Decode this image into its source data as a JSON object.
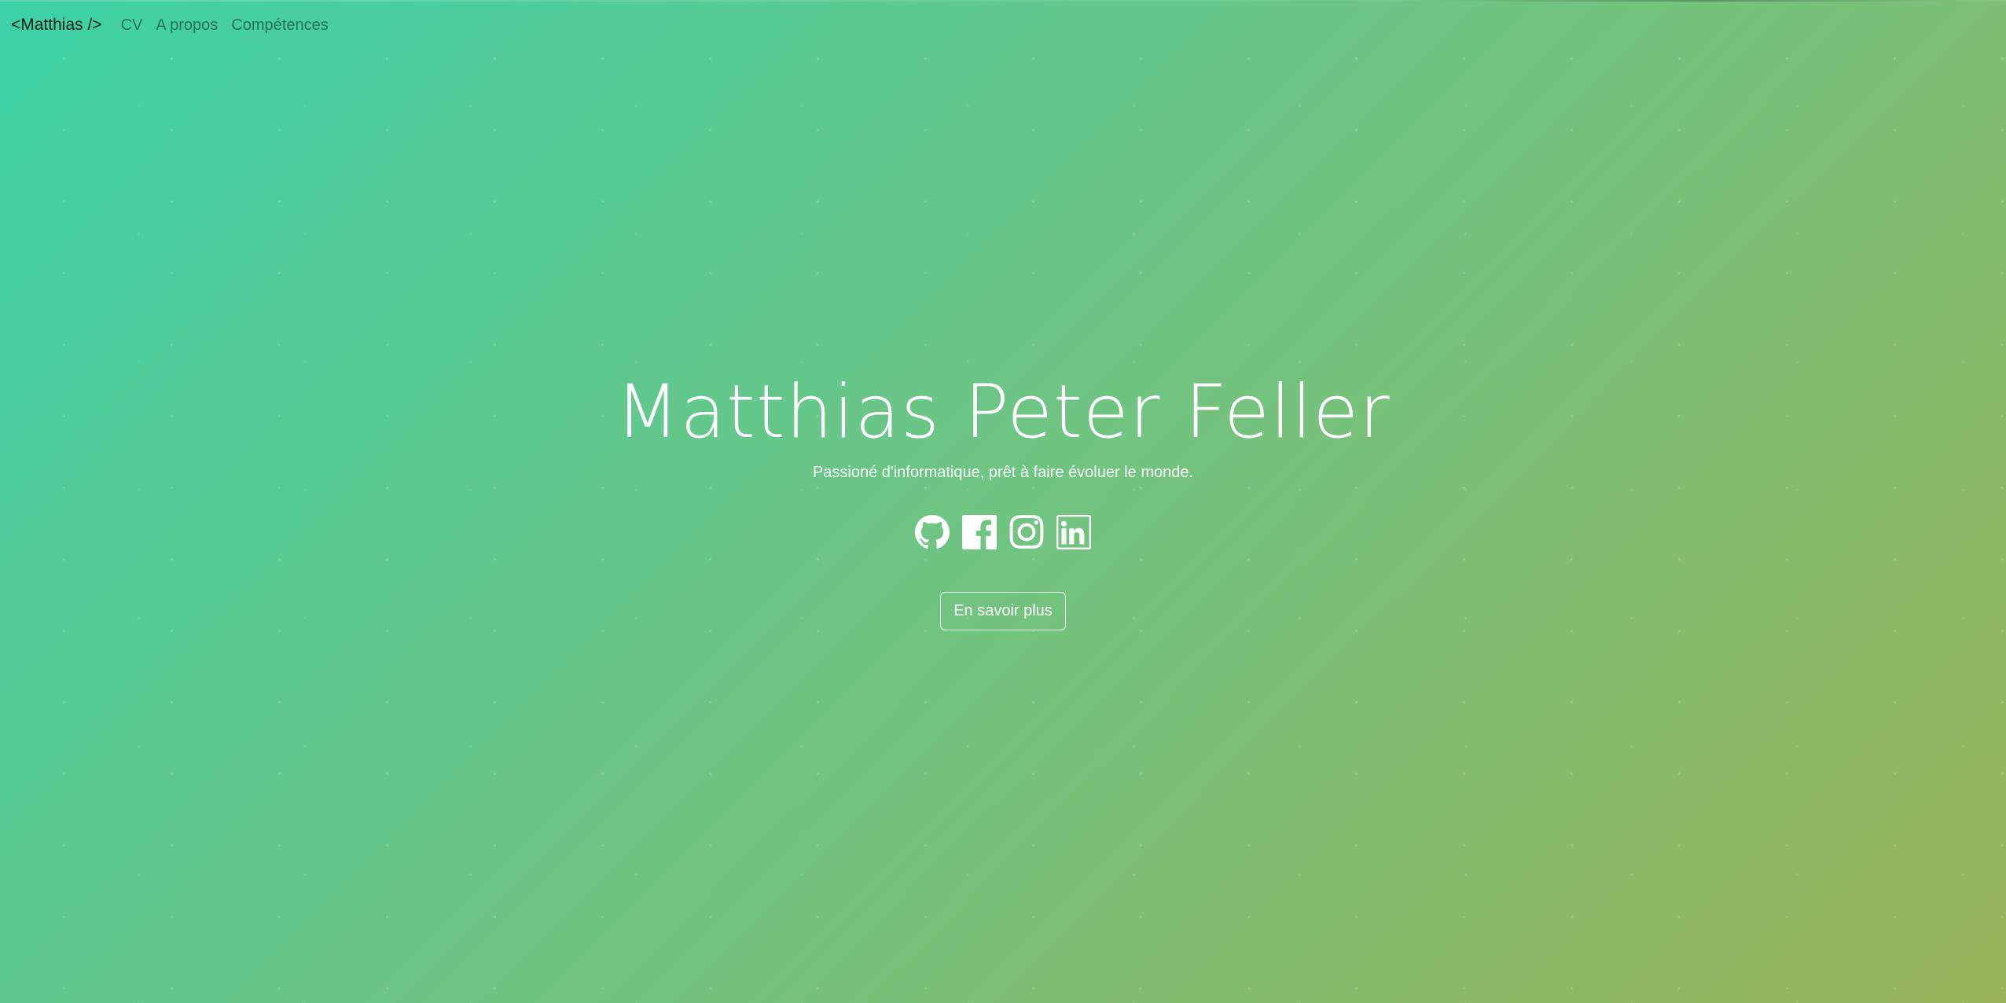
{
  "nav": {
    "brand": "<Matthias />",
    "links": [
      "CV",
      "A propos",
      "Compétences"
    ]
  },
  "hero": {
    "name": "Matthias Peter Feller",
    "tagline": "Passioné d'informatique, prêt à faire évoluer le monde.",
    "cta_label": "En savoir plus"
  },
  "social": {
    "icons": [
      "github-icon",
      "facebook-icon",
      "instagram-icon",
      "linkedin-icon"
    ]
  },
  "colors": {
    "gradient_start": "#3dd1a8",
    "gradient_mid": "#6ec584",
    "gradient_end": "#9ab55a",
    "text": "#ffffff",
    "brand_text": "#0d1f16"
  }
}
